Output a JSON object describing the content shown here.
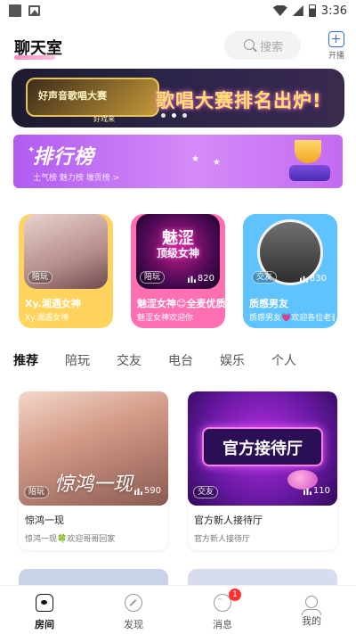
{
  "status_bar": {
    "time": "3:36"
  },
  "header": {
    "title": "聊天室",
    "search_placeholder": "搜索",
    "open_label": "开播"
  },
  "banner": {
    "left_text": "好声音歌唱大赛",
    "left_sub": "好戏来",
    "title": "歌唱大赛排名出炉!",
    "active_dot": 1,
    "dot_count": 3
  },
  "ranking": {
    "title": "排行榜",
    "subtitle": "土气榜  魅力榜  壕贡榜  >"
  },
  "featured": [
    {
      "image_text": "Xy.湘遇女神",
      "tag": "陪玩",
      "name": "Xy.湘遇女神",
      "desc": "Xy.湘遇女神",
      "bg": "#ffd35c"
    },
    {
      "image_text": "魅涩",
      "image_text2": "顶级女神",
      "tag": "陪玩",
      "count": "820",
      "name": "魅涩女神😊全麦优质",
      "desc": "魅涩女神欢迎你",
      "bg": "#ff6fb2"
    },
    {
      "image_text": "质感男友",
      "tag": "交友",
      "count": "830",
      "name": "质感男友",
      "desc": "质感男友💗欢迎各位老婆...",
      "bg": "#5ec3ff"
    }
  ],
  "tabs": [
    "推荐",
    "陪玩",
    "交友",
    "电台",
    "娱乐",
    "个人"
  ],
  "rooms": [
    {
      "image_text": "惊鸿一现",
      "tag": "陪玩",
      "count": "590",
      "name": "惊鸿一现",
      "desc": "惊鸿一现🍀欢迎哥哥回家"
    },
    {
      "image_text": "官方接待厅",
      "tag": "交友",
      "count": "110",
      "name": "官方新人接待厅",
      "desc": "官方新人接待厅"
    }
  ],
  "bottom_nav": [
    {
      "label": "房间",
      "icon": "home-icon",
      "active": true
    },
    {
      "label": "发现",
      "icon": "discover-icon",
      "active": false
    },
    {
      "label": "消息",
      "icon": "message-icon",
      "active": false,
      "badge": "1"
    },
    {
      "label": "我的",
      "icon": "profile-icon",
      "active": false
    }
  ],
  "colors": {
    "accent_pink": "#ff6fb1",
    "accent_blue": "#2f6cf5",
    "badge_red": "#ff3030"
  }
}
